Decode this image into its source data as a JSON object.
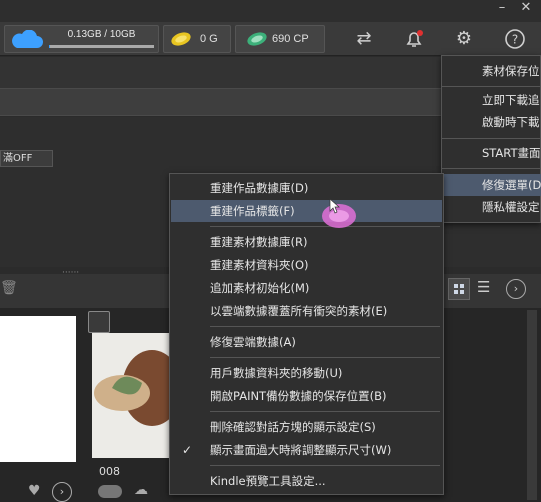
{
  "window": {
    "minimize": "–",
    "close": "✕"
  },
  "toolbar": {
    "storage_text": "0.13GB / 10GB",
    "storage_fill_fraction": 0.013,
    "gold_value": "0 G",
    "cp_value": "690 CP"
  },
  "filter_chip": "滿OFF",
  "right_menu": {
    "items": [
      "素材保存位",
      "立即下載追",
      "啟動時下載",
      "START畫面",
      "修復選單(D",
      "隱私權設定"
    ]
  },
  "left_menu": {
    "items": [
      "重建作品數據庫(D)",
      "重建作品標籤(F)",
      "重建素材數據庫(R)",
      "重建素材資料夾(O)",
      "追加素材初始化(M)",
      "以雲端數據覆蓋所有衝突的素材(E)",
      "修復雲端數據(A)",
      "用戶數據資料夾的移動(U)",
      "開啟PAINT備份數據的保存位置(B)",
      "刪除確認對話方塊的顯示設定(S)",
      "顯示畫面過大時將調整顯示尺寸(W)",
      "Kindle預覽工具設定..."
    ],
    "checkmark": "✓"
  },
  "gallery": {
    "item_label": "008"
  },
  "colors": {
    "accent_blue": "#3da0ff",
    "highlight": "#4d5a6e",
    "menu_bg": "#2f2f2f"
  }
}
